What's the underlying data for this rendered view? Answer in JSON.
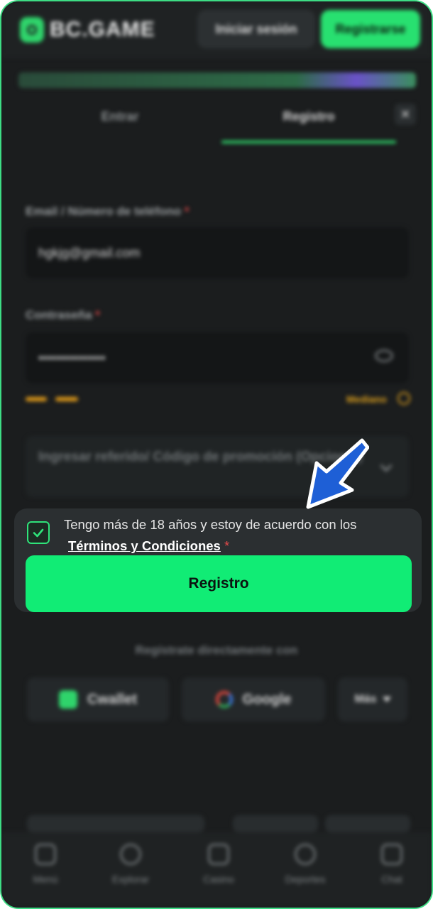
{
  "header": {
    "logo_text": "BC.GAME",
    "login_label": "Iniciar sesión",
    "register_label": "Registrarse"
  },
  "tabs": {
    "enter_label": "Entrar",
    "register_label": "Registro"
  },
  "form": {
    "email_label": "Email / Número de teléfono",
    "email_value": "hgkjg@gmail.com",
    "password_label": "Contraseña",
    "password_value": "•••••••••••••••",
    "strength_label": "Mediano",
    "promo_placeholder": "Ingresar referido/ Código de promoción (Opcional)",
    "required_mark": "*"
  },
  "consent": {
    "text": "Tengo más de 18 años y estoy de acuerdo con los",
    "link_text": "Términos y Condiciones",
    "required_mark": "*",
    "checked": true,
    "submit_label": "Registro"
  },
  "social": {
    "heading": "Regístrate directamente con",
    "cwallet_label": "Cwallet",
    "google_label": "Google",
    "more_label": "Más"
  },
  "nav": {
    "items": [
      "Menú",
      "Explorar",
      "Casino",
      "Deportes",
      "Chat"
    ]
  },
  "colors": {
    "accent": "#11ec75",
    "frame_border": "#3ddc84",
    "arrow": "#1e5fd6"
  }
}
